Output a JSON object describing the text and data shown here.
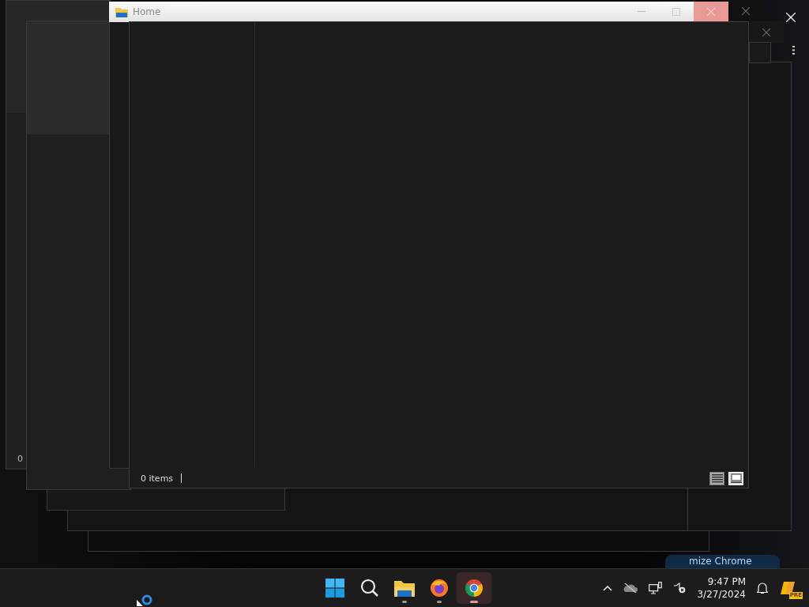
{
  "background_window": {
    "status_text": "0"
  },
  "explorer": {
    "title": "Home",
    "status_text": "0 items",
    "views": [
      {
        "kind": "details",
        "selected": false
      },
      {
        "kind": "tiles",
        "selected": true
      }
    ]
  },
  "chrome_button": {
    "label": "mize Chrome"
  },
  "taskbar": {
    "apps": [
      {
        "kind": "start",
        "running": false,
        "selected": false
      },
      {
        "kind": "search",
        "running": false,
        "selected": false
      },
      {
        "kind": "explorer",
        "running": true,
        "selected": false
      },
      {
        "kind": "firefox",
        "running": true,
        "selected": false
      },
      {
        "kind": "chrome",
        "running": true,
        "selected": true
      }
    ],
    "clock": {
      "time": "9:47 PM",
      "date": "3/27/2024"
    },
    "copilot_badge": "PRE"
  }
}
